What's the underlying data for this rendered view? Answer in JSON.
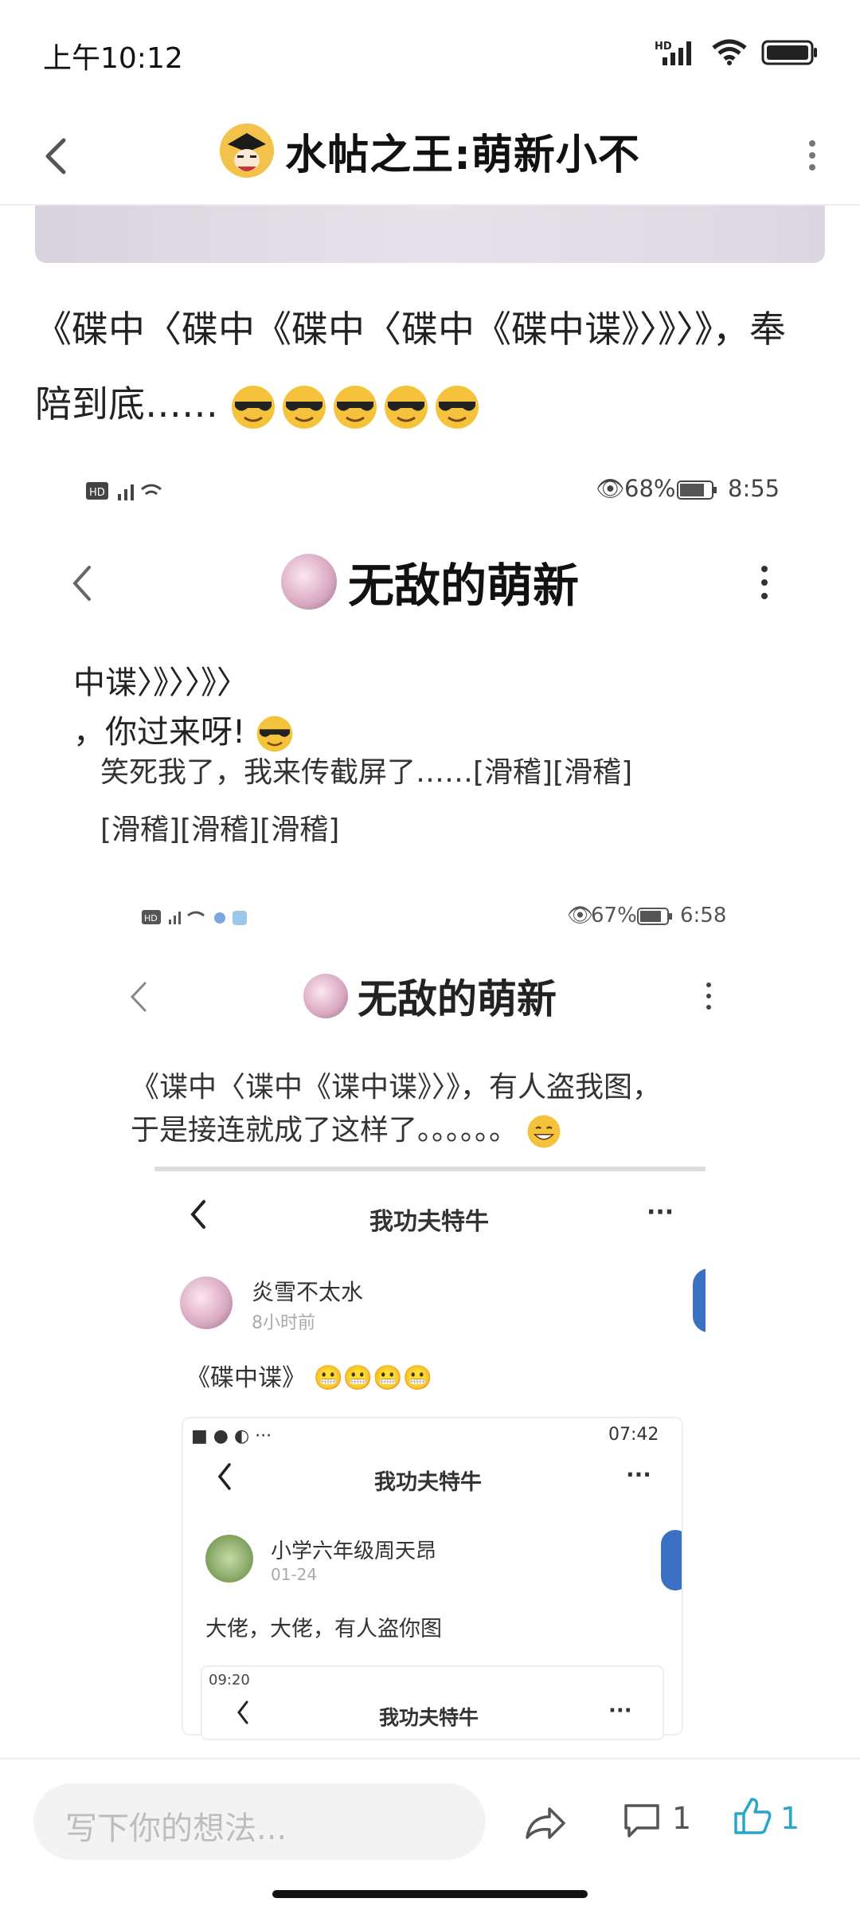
{
  "status_bar": {
    "time": "上午10:12",
    "network_label": "HD"
  },
  "header": {
    "title": "水帖之王:萌新小不"
  },
  "post": {
    "line1": "《碟中〈碟中《碟中〈碟中《碟中谍》〉》〉》，奉",
    "line2": "陪到底……"
  },
  "screenshot1": {
    "status_right": "68%",
    "status_time": "8:55",
    "title": "无敌的萌新",
    "text_line1": "中谍〉》〉〉》〉",
    "text_line2": "，你过来呀!",
    "text_line3": "笑死我了，我来传截屏了……[滑稽][滑稽]",
    "text_line4": "[滑稽][滑稽][滑稽]"
  },
  "screenshot2": {
    "status_right": "67%",
    "status_time": "6:58",
    "title": "无敌的萌新",
    "text_line1": "《谍中〈谍中《谍中谍》〉》，有人盗我图，",
    "text_line2": "于是接连就成了这样了。。。。。。"
  },
  "screenshot3": {
    "title": "我功夫特牛",
    "user": "炎雪不太水",
    "time": "8小时前",
    "text": "《碟中谍》"
  },
  "screenshot4": {
    "status_time": "07:42",
    "title": "我功夫特牛",
    "user": "小学六年级周天昂",
    "date": "01-24",
    "text": "大佬，大佬，有人盗你图"
  },
  "screenshot5": {
    "status_time": "09:20",
    "title": "我功夫特牛"
  },
  "bottom_bar": {
    "input_placeholder": "写下你的想法...",
    "comment_count": "1",
    "like_count": "1"
  },
  "colors": {
    "accent": "#2aa6c9",
    "text": "#222222",
    "placeholder": "#bdbdbd"
  }
}
